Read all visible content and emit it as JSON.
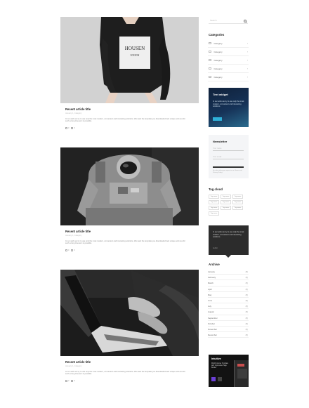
{
  "articles": [
    {
      "title": "Recent article title",
      "meta": "January 1, Category",
      "excerpt": "In our work we try to use only the most modern, convenient and interesting solutions. We want the template you downloaded look unique and new for such a long time as it is possible.",
      "likes": "0",
      "comments": "0"
    },
    {
      "title": "Recent article title",
      "meta": "January 1, Category",
      "excerpt": "In our work we try to use only the most modern, convenient and interesting solutions. We want the template you downloaded look unique and new for such a long time as it is possible.",
      "likes": "0",
      "comments": "0"
    },
    {
      "title": "Recent article title",
      "meta": "January 1, Category",
      "excerpt": "In our work we try to use only the most modern, convenient and interesting solutions. We want the template you downloaded look unique and new for such a long time as it is possible.",
      "likes": "0",
      "comments": "0"
    }
  ],
  "sidebar": {
    "search_placeholder": "Search",
    "categories_title": "Categories",
    "categories": [
      "Category",
      "Category",
      "Category",
      "Category",
      "Category"
    ],
    "text_widget": {
      "title": "Text widget",
      "text": "In our work we try to use only the most modern, convenient and interesting solutions."
    },
    "newsletter": {
      "title": "Newsletter",
      "field1": "Your name",
      "field2": "Your email",
      "fine_print": "By subscribing you agree to our Terms and Privacy Policy."
    },
    "tag_cloud_title": "Tag cloud",
    "tags": [
      "Tag name",
      "Tag name",
      "Tag name",
      "Tag name",
      "Tag name",
      "Tag name",
      "Tag name",
      "Tag name",
      "Tag name",
      "Tag name"
    ],
    "quote": {
      "text": "In our work we try to use only the most modern, convenient and interesting solutions.",
      "author": "Author"
    },
    "archive_title": "Archive",
    "archive": [
      {
        "month": "January",
        "count": "(5)"
      },
      {
        "month": "February",
        "count": "(5)"
      },
      {
        "month": "March",
        "count": "(5)"
      },
      {
        "month": "April",
        "count": "(5)"
      },
      {
        "month": "May",
        "count": "(5)"
      },
      {
        "month": "June",
        "count": "(5)"
      },
      {
        "month": "July",
        "count": "(5)"
      },
      {
        "month": "August",
        "count": "(5)"
      },
      {
        "month": "September",
        "count": "(5)"
      },
      {
        "month": "October",
        "count": "(5)"
      },
      {
        "month": "November",
        "count": "(5)"
      },
      {
        "month": "December",
        "count": "(5)"
      }
    ],
    "promo": {
      "logo": "Intuitive",
      "text": "Multi-Purpose Template with Impressive Page Builder"
    }
  },
  "colors": {
    "accent": "#2fb0d8",
    "dark": "#2c2c2c",
    "text_widget_bg": "#163358"
  }
}
